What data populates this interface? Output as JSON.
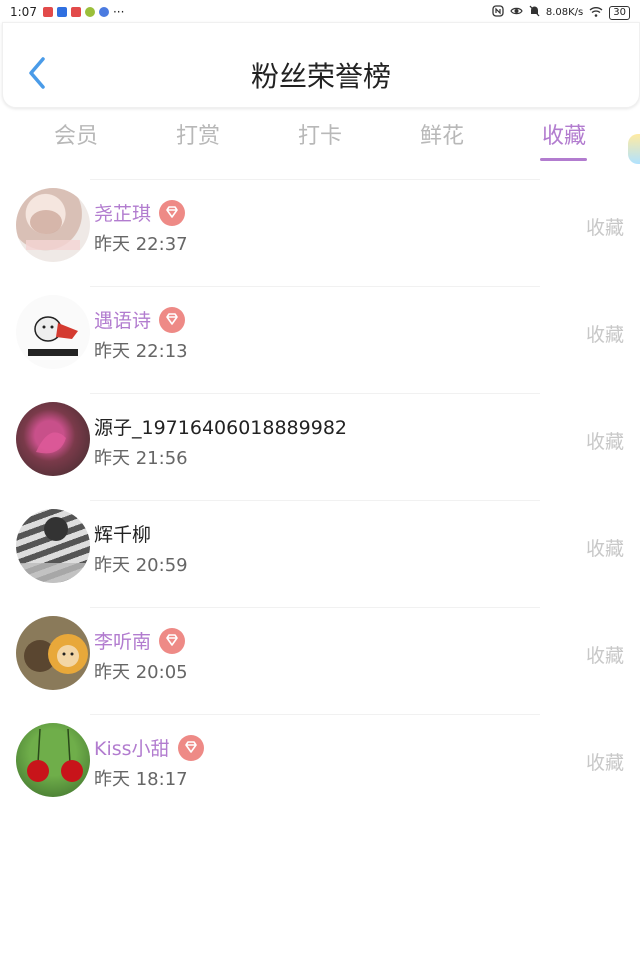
{
  "status_bar": {
    "time": "1:07",
    "more": "···",
    "network_speed": "8.08K/s",
    "battery": "30"
  },
  "header": {
    "title": "粉丝荣誉榜"
  },
  "tabs": [
    {
      "label": "会员",
      "active": false
    },
    {
      "label": "打赏",
      "active": false
    },
    {
      "label": "打卡",
      "active": false
    },
    {
      "label": "鲜花",
      "active": false
    },
    {
      "label": "收藏",
      "active": true
    }
  ],
  "fans": [
    {
      "name": "尧芷琪",
      "time": "昨天 22:37",
      "vip": true,
      "action": "收藏"
    },
    {
      "name": "遇语诗",
      "time": "昨天 22:13",
      "vip": true,
      "action": "收藏"
    },
    {
      "name": "源子_19716406018889982",
      "time": "昨天 21:56",
      "vip": false,
      "action": "收藏"
    },
    {
      "name": "辉千柳",
      "time": "昨天 20:59",
      "vip": false,
      "action": "收藏"
    },
    {
      "name": "李听南",
      "time": "昨天 20:05",
      "vip": true,
      "action": "收藏"
    },
    {
      "name": "Kiss小甜",
      "time": "昨天 18:17",
      "vip": true,
      "action": "收藏"
    }
  ],
  "colors": {
    "accent": "#b27ccf",
    "vip_badge": "#ee8a86",
    "back_arrow": "#4a9be8"
  }
}
